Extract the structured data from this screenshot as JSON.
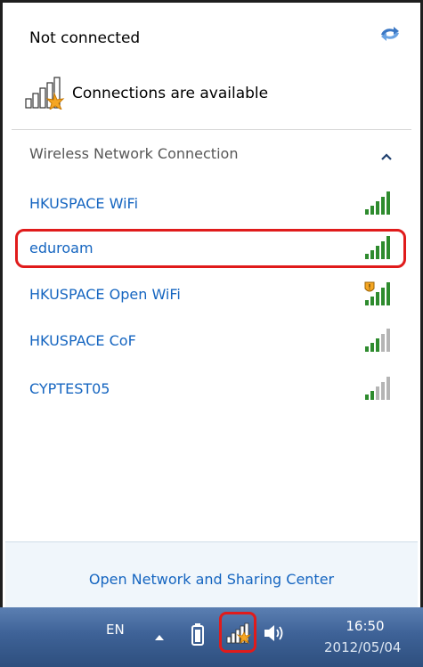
{
  "popup": {
    "status": "Not connected",
    "available_label": "Connections are available",
    "section_title": "Wireless Network Connection",
    "networks": [
      {
        "name": "HKUSPACE WiFi",
        "signal_bars": 5,
        "secured_warning": false
      },
      {
        "name": "eduroam",
        "signal_bars": 5,
        "secured_warning": false,
        "highlighted": true
      },
      {
        "name": "HKUSPACE Open WiFi",
        "signal_bars": 5,
        "secured_warning": true
      },
      {
        "name": "HKUSPACE CoF",
        "signal_bars": 3,
        "secured_warning": false
      },
      {
        "name": "CYPTEST05",
        "signal_bars": 2,
        "secured_warning": false
      }
    ],
    "footer_link": "Open Network and Sharing Center"
  },
  "taskbar": {
    "language": "EN",
    "time": "16:50",
    "date": "2012/05/04"
  },
  "colors": {
    "link": "#1565c0",
    "highlight_outline": "#e01b1b",
    "signal_on": "#2e8b2e",
    "signal_off": "#b5b5b5",
    "warning_star": "#f5a623"
  }
}
